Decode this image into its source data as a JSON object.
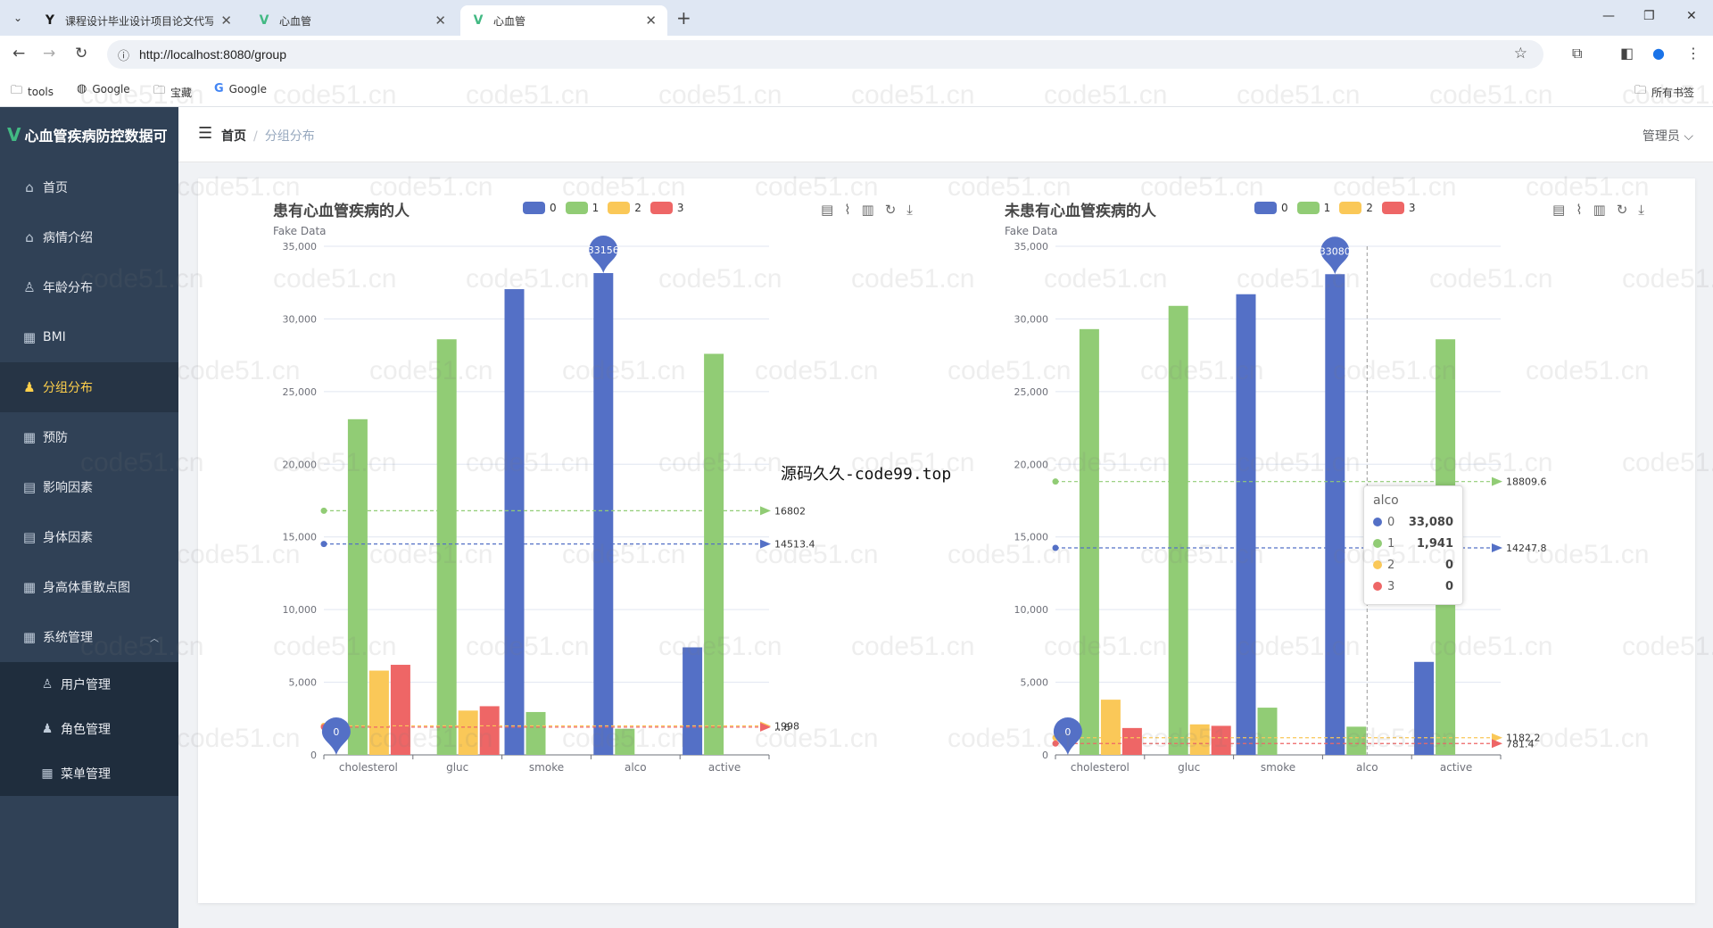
{
  "browser": {
    "tabs": [
      {
        "label": "课程设计毕业设计项目论文代写",
        "favicon": "Y",
        "active": false
      },
      {
        "label": "心血管",
        "favicon": "V",
        "active": false
      },
      {
        "label": "心血管",
        "favicon": "V",
        "active": true
      }
    ],
    "url": "http://localhost:8080/group",
    "bookmarks": [
      "tools",
      "Google",
      "宝藏",
      "Google"
    ],
    "all_bookmarks": "所有书签"
  },
  "app": {
    "title": "心血管疾病防控数据可",
    "breadcrumb": {
      "home": "首页",
      "current": "分组分布"
    },
    "user": "管理员"
  },
  "sidebar": {
    "items": [
      {
        "label": "首页",
        "icon": "home-icon"
      },
      {
        "label": "病情介绍",
        "icon": "home-icon"
      },
      {
        "label": "年龄分布",
        "icon": "user-icon"
      },
      {
        "label": "BMI",
        "icon": "grid-icon"
      },
      {
        "label": "分组分布",
        "icon": "user-icon",
        "active": true
      },
      {
        "label": "预防",
        "icon": "grid-icon"
      },
      {
        "label": "影响因素",
        "icon": "document-icon"
      },
      {
        "label": "身体因素",
        "icon": "document-icon"
      },
      {
        "label": "身高体重散点图",
        "icon": "grid-icon"
      },
      {
        "label": "系统管理",
        "icon": "grid-icon"
      }
    ],
    "sub_items": [
      {
        "label": "用户管理",
        "icon": "user-icon"
      },
      {
        "label": "角色管理",
        "icon": "user-icon"
      },
      {
        "label": "菜单管理",
        "icon": "grid-icon"
      }
    ]
  },
  "colors": {
    "s0": "#5470c6",
    "s1": "#91cc75",
    "s2": "#fac858",
    "s3": "#ee6666"
  },
  "overlay_text": "源码久久-code99.top",
  "watermark": "code51.cn",
  "chart_data": [
    {
      "type": "bar",
      "title": "患有心血管疾病的人",
      "subtitle": "Fake Data",
      "categories": [
        "cholesterol",
        "gluc",
        "smoke",
        "alco",
        "active"
      ],
      "ylim": [
        0,
        35000
      ],
      "yticks": [
        "0",
        "5,000",
        "10,000",
        "15,000",
        "20,000",
        "25,000",
        "30,000",
        "35,000"
      ],
      "series": [
        {
          "name": "0",
          "values": [
            0,
            0,
            32050,
            33156,
            7400
          ]
        },
        {
          "name": "1",
          "values": [
            23100,
            28600,
            2950,
            1800,
            27600
          ]
        },
        {
          "name": "2",
          "values": [
            5800,
            3050,
            0,
            0,
            0
          ]
        },
        {
          "name": "3",
          "values": [
            6200,
            3350,
            0,
            0,
            0
          ]
        }
      ],
      "mark_points": [
        {
          "series": "0",
          "label": "0",
          "category": "cholesterol"
        },
        {
          "series": "0",
          "label": "33156",
          "category": "alco"
        }
      ],
      "mark_lines": [
        {
          "series": "1",
          "value": 16802,
          "label": "16802"
        },
        {
          "series": "0",
          "value": 14513.4,
          "label": "14513.4"
        },
        {
          "series": "2",
          "value": 1998,
          "label": "1998"
        },
        {
          "series": "3",
          "value": 1910.6,
          "label": "...6"
        }
      ]
    },
    {
      "type": "bar",
      "title": "未患有心血管疾病的人",
      "subtitle": "Fake Data",
      "categories": [
        "cholesterol",
        "gluc",
        "smoke",
        "alco",
        "active"
      ],
      "ylim": [
        0,
        35000
      ],
      "yticks": [
        "0",
        "5,000",
        "10,000",
        "15,000",
        "20,000",
        "25,000",
        "30,000",
        "35,000"
      ],
      "series": [
        {
          "name": "0",
          "values": [
            0,
            0,
            31700,
            33080,
            6400
          ]
        },
        {
          "name": "1",
          "values": [
            29300,
            30900,
            3250,
            1941,
            28600
          ]
        },
        {
          "name": "2",
          "values": [
            3800,
            2100,
            0,
            0,
            0
          ]
        },
        {
          "name": "3",
          "values": [
            1850,
            2000,
            0,
            0,
            0
          ]
        }
      ],
      "mark_points": [
        {
          "series": "0",
          "label": "0",
          "category": "cholesterol"
        },
        {
          "series": "0",
          "label": "33080",
          "category": "alco"
        }
      ],
      "mark_lines": [
        {
          "series": "1",
          "value": 18809.6,
          "label": "18809.6"
        },
        {
          "series": "0",
          "value": 14247.8,
          "label": "14247.8"
        },
        {
          "series": "2",
          "value": 1182.2,
          "label": "1182.2"
        },
        {
          "series": "3",
          "value": 781.4,
          "label": "781.4"
        }
      ],
      "tooltip": {
        "title": "alco",
        "rows": [
          {
            "name": "0",
            "value": "33,080"
          },
          {
            "name": "1",
            "value": "1,941"
          },
          {
            "name": "2",
            "value": "0"
          },
          {
            "name": "3",
            "value": "0"
          }
        ]
      }
    }
  ]
}
